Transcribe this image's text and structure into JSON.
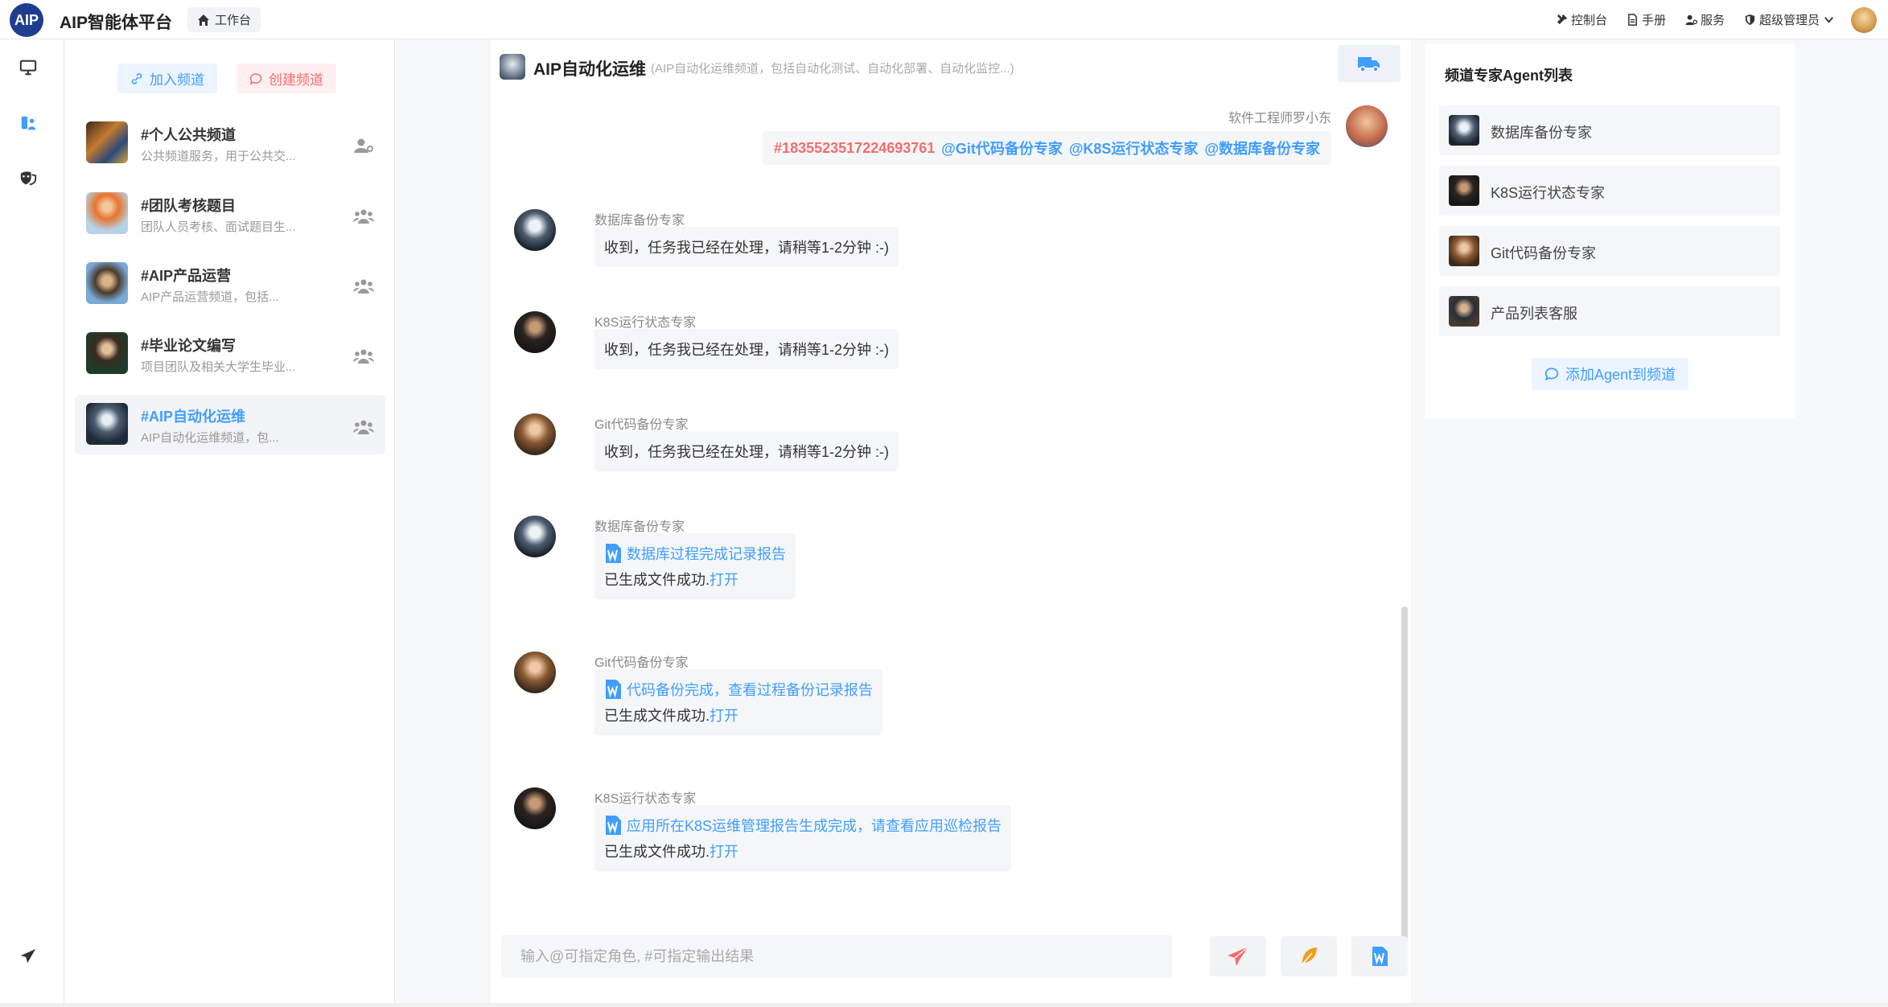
{
  "app": {
    "logo_text": "AIP",
    "title": "AIP智能体平台",
    "workbench_label": "工作台"
  },
  "top_nav": {
    "console": "控制台",
    "manual": "手册",
    "service": "服务",
    "admin": "超级管理员"
  },
  "channels_panel": {
    "join_label": "加入频道",
    "create_label": "创建频道",
    "items": [
      {
        "name": "#个人公共频道",
        "desc": "公共频道服务，用于公共交..."
      },
      {
        "name": "#团队考核题目",
        "desc": "团队人员考核、面试题目生..."
      },
      {
        "name": "#AIP产品运营",
        "desc": "AIP产品运营频道，包括..."
      },
      {
        "name": "#毕业论文编写",
        "desc": "项目团队及相关大学生毕业..."
      },
      {
        "name": "#AIP自动化运维",
        "desc": "AIP自动化运维频道，包..."
      }
    ]
  },
  "chat": {
    "title": "AIP自动化运维",
    "subtitle": "(AIP自动化运维频道，包括自动化测试、自动化部署、自动化监控...)",
    "sender": {
      "name": "软件工程师罗小东",
      "ticket": "#1835523517224693761",
      "mentions": [
        "@Git代码备份专家",
        "@K8S运行状态专家",
        "@数据库备份专家"
      ]
    },
    "messages": [
      {
        "name": "数据库备份专家",
        "text": "收到，任务我已经在处理，请稍等1-2分钟 :-)"
      },
      {
        "name": "K8S运行状态专家",
        "text": "收到，任务我已经在处理，请稍等1-2分钟 :-)"
      },
      {
        "name": "Git代码备份专家",
        "text": "收到，任务我已经在处理，请稍等1-2分钟 :-)"
      }
    ],
    "file_messages": [
      {
        "name": "数据库备份专家",
        "file": "数据库过程完成记录报告",
        "status": "已生成文件成功.",
        "open": "打开"
      },
      {
        "name": "Git代码备份专家",
        "file": "代码备份完成，查看过程备份记录报告",
        "status": "已生成文件成功.",
        "open": "打开"
      },
      {
        "name": "K8S运行状态专家",
        "file": "应用所在K8S运维管理报告生成完成，请查看应用巡检报告",
        "status": "已生成文件成功.",
        "open": "打开"
      }
    ],
    "input_placeholder": "输入@可指定角色, #可指定输出结果"
  },
  "agents_panel": {
    "title": "频道专家Agent列表",
    "items": [
      "数据库备份专家",
      "K8S运行状态专家",
      "Git代码备份专家",
      "产品列表客服"
    ],
    "add_label": "添加Agent到频道"
  },
  "colors": {
    "accent": "#409eff",
    "danger": "#f56c6c",
    "logo": "#1e3d8f",
    "send_icon": "#f56c6c",
    "feather_icon": "#f0a020"
  }
}
